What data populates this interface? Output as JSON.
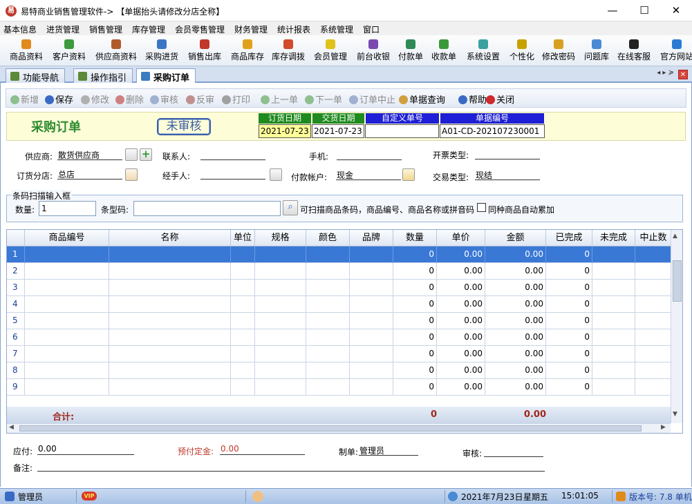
{
  "window": {
    "title": "易特商业销售管理软件-> 【单据抬头请修改分店全称】",
    "min": "—",
    "max": "☐",
    "close": "✕"
  },
  "menu": [
    "基本信息",
    "进货管理",
    "销售管理",
    "库存管理",
    "会员零售管理",
    "财务管理",
    "统计报表",
    "系统管理",
    "窗口"
  ],
  "toolbar": [
    {
      "label": "商品资料",
      "color": "#e08a1c"
    },
    {
      "label": "客户资料",
      "color": "#3e9a3e"
    },
    {
      "label": "供应商资料",
      "color": "#b05a2a"
    },
    {
      "label": "采购进货",
      "color": "#3a76c4"
    },
    {
      "label": "销售出库",
      "color": "#c0392b"
    },
    {
      "label": "商品库存",
      "color": "#e0a21c"
    },
    {
      "label": "库存调拨",
      "color": "#d14a2a"
    },
    {
      "label": "会员管理",
      "color": "#e0c21c"
    },
    {
      "label": "前台收银",
      "color": "#7a4ab0"
    },
    {
      "label": "付款单",
      "color": "#2e8b57"
    },
    {
      "label": "收款单",
      "color": "#3a9a3a"
    },
    {
      "label": "系统设置",
      "color": "#3aa0a0"
    },
    {
      "label": "个性化",
      "color": "#c8a000"
    },
    {
      "label": "修改密码",
      "color": "#d8a020"
    },
    {
      "label": "问题库",
      "color": "#4a8ad4"
    },
    {
      "label": "在线客服",
      "color": "#222222"
    },
    {
      "label": "官方网站",
      "color": "#2a7ad4"
    }
  ],
  "tabs": [
    "功能导航",
    "操作指引",
    "采购订单"
  ],
  "tab_controls": "◂ ▸ ≽",
  "doc_toolbar": [
    {
      "label": "新增",
      "enabled": false,
      "color": "#8fbf8f"
    },
    {
      "label": "保存",
      "enabled": true,
      "color": "#3a6ac4"
    },
    {
      "label": "修改",
      "enabled": false,
      "color": "#b0b0b0"
    },
    {
      "label": "删除",
      "enabled": false,
      "color": "#d08080"
    },
    {
      "label": "审核",
      "enabled": false,
      "color": "#a0b0d0"
    },
    {
      "label": "反审",
      "enabled": false,
      "color": "#c09090"
    },
    {
      "label": "打印",
      "enabled": false,
      "color": "#a0a0a0"
    },
    {
      "label": "上一单",
      "enabled": false,
      "color": "#8fbf8f"
    },
    {
      "label": "下一单",
      "enabled": false,
      "color": "#8fbf8f"
    },
    {
      "label": "订单中止",
      "enabled": false,
      "color": "#a0b0d0"
    },
    {
      "label": "单据查询",
      "enabled": true,
      "color": "#d0a040"
    },
    {
      "label": "帮助",
      "enabled": true,
      "color": "#3a6ac4"
    },
    {
      "label": "关闭",
      "enabled": true,
      "color": "#d02a2a"
    }
  ],
  "header": {
    "doc_title": "采购订单",
    "status": "未审核",
    "order_date_label": "订货日期",
    "order_date": "2021-07-23",
    "delivery_date_label": "交货日期",
    "delivery_date": "2021-07-23",
    "custom_no_label": "自定义单号",
    "custom_no": "",
    "doc_no_label": "单据编号",
    "doc_no": "A01-CD-202107230001"
  },
  "form": {
    "supplier_label": "供应商:",
    "supplier": "散货供应商",
    "contact_label": "联系人:",
    "contact": "",
    "phone_label": "手机:",
    "phone": "",
    "invoice_label": "开票类型:",
    "invoice": "",
    "branch_label": "订货分店:",
    "branch": "总店",
    "handler_label": "经手人:",
    "handler": "",
    "account_label": "付款帐户:",
    "account": "现金",
    "trade_label": "交易类型:",
    "trade": "现结"
  },
  "scan": {
    "legend": "条码扫描输入框",
    "qty_label": "数量:",
    "qty": "1",
    "barcode_label": "条型码:",
    "barcode": "",
    "hint": "可扫描商品条码，商品编号、商品名称或拼音码",
    "accumulate_label": "同种商品自动累加"
  },
  "grid": {
    "columns": [
      "",
      "商品编号",
      "名称",
      "单位",
      "规格",
      "颜色",
      "品牌",
      "数量",
      "单价",
      "金额",
      "已完成",
      "未完成",
      "中止数"
    ],
    "rows": [
      {
        "n": "1",
        "qty": "0",
        "price": "0.00",
        "amount": "0.00",
        "done": "0"
      },
      {
        "n": "2",
        "qty": "0",
        "price": "0.00",
        "amount": "0.00",
        "done": "0"
      },
      {
        "n": "3",
        "qty": "0",
        "price": "0.00",
        "amount": "0.00",
        "done": "0"
      },
      {
        "n": "4",
        "qty": "0",
        "price": "0.00",
        "amount": "0.00",
        "done": "0"
      },
      {
        "n": "5",
        "qty": "0",
        "price": "0.00",
        "amount": "0.00",
        "done": "0"
      },
      {
        "n": "6",
        "qty": "0",
        "price": "0.00",
        "amount": "0.00",
        "done": "0"
      },
      {
        "n": "7",
        "qty": "0",
        "price": "0.00",
        "amount": "0.00",
        "done": "0"
      },
      {
        "n": "8",
        "qty": "0",
        "price": "0.00",
        "amount": "0.00",
        "done": "0"
      },
      {
        "n": "9",
        "qty": "0",
        "price": "0.00",
        "amount": "0.00",
        "done": "0"
      }
    ],
    "sum_label": "合计:",
    "sum_qty": "0",
    "sum_amount": "0.00"
  },
  "footer": {
    "payable_label": "应付:",
    "payable": "0.00",
    "deposit_label": "预付定金:",
    "deposit": "0.00",
    "maker_label": "制单:",
    "maker": "管理员",
    "auditor_label": "审核:",
    "auditor": "",
    "remark_label": "备注:",
    "remark": ""
  },
  "statusbar": {
    "user": "管理员",
    "vip": "VIP",
    "date": "2021年7月23日",
    "weekday": "星期五",
    "time": "15:01:05",
    "version": "版本号: 7.8 单机"
  },
  "colors": {
    "accent": "#3a78d6",
    "header_green": "#1f8a1f",
    "header_blue": "#1f1fd6",
    "sum_red": "#a0281e",
    "deposit_red": "#c0392b"
  }
}
